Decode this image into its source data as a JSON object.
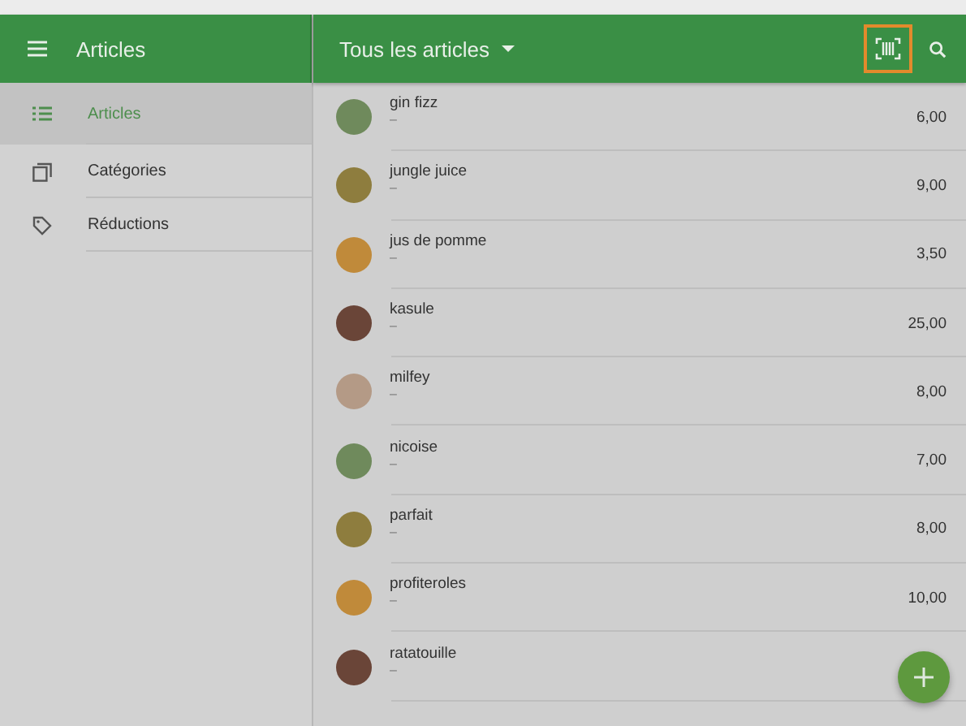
{
  "sidebar": {
    "title": "Articles",
    "items": [
      {
        "label": "Articles",
        "kind": "list",
        "selected": true
      },
      {
        "label": "Catégories",
        "kind": "copy",
        "selected": false
      },
      {
        "label": "Réductions",
        "kind": "tag",
        "selected": false
      }
    ]
  },
  "main": {
    "title": "Tous les articles",
    "scan_highlighted": true
  },
  "articles": [
    {
      "name": "gin fizz",
      "detail": "–",
      "price": "6,00"
    },
    {
      "name": "jungle juice",
      "detail": "–",
      "price": "9,00"
    },
    {
      "name": "jus de pomme",
      "detail": "–",
      "price": "3,50"
    },
    {
      "name": "kasule",
      "detail": "–",
      "price": "25,00"
    },
    {
      "name": "milfey",
      "detail": "–",
      "price": "8,00"
    },
    {
      "name": "nicoise",
      "detail": "–",
      "price": "7,00"
    },
    {
      "name": "parfait",
      "detail": "–",
      "price": "8,00"
    },
    {
      "name": "profiteroles",
      "detail": "–",
      "price": "10,00"
    },
    {
      "name": "ratatouille",
      "detail": "–"
    }
  ]
}
